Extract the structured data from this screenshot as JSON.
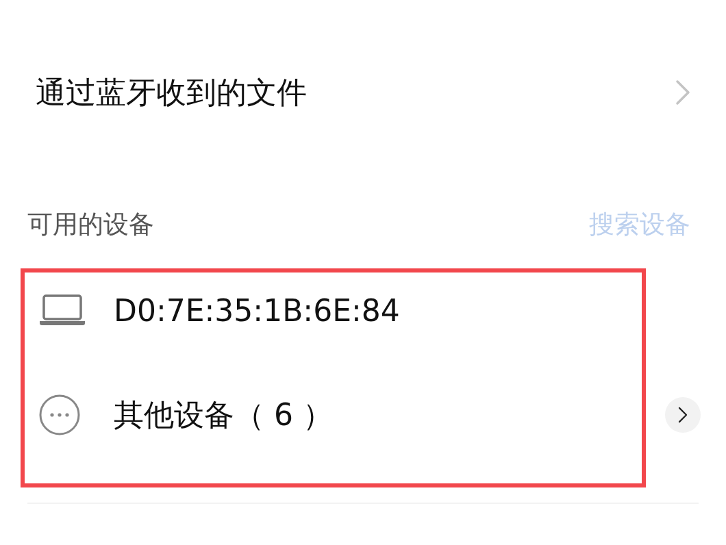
{
  "received_files": {
    "label": "通过蓝牙收到的文件"
  },
  "available_devices": {
    "title": "可用的设备",
    "search_action": {
      "label": "搜索设备",
      "disabled": true
    },
    "highlighted": true,
    "items": [
      {
        "kind": "laptop",
        "name": "D0:7E:35:1B:6E:84"
      },
      {
        "kind": "more",
        "name": "其他设备（ 6 ）"
      }
    ]
  }
}
